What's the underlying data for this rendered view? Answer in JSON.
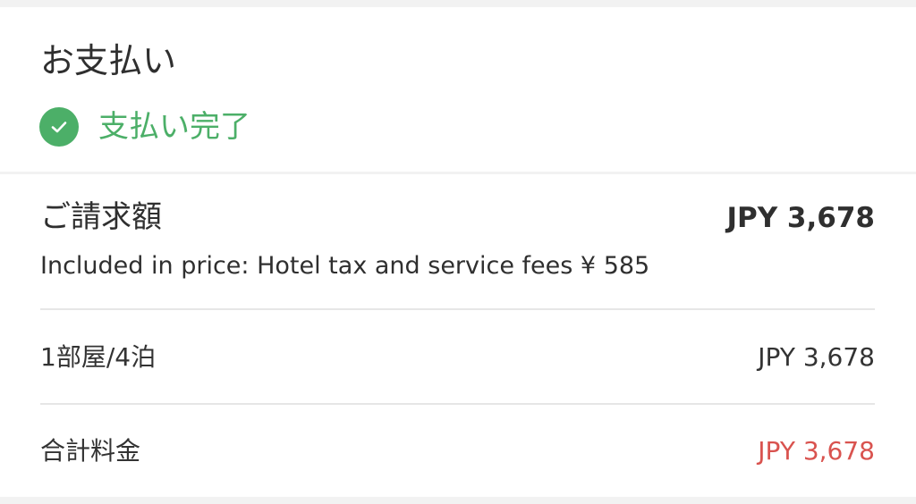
{
  "payment": {
    "title": "お支払い",
    "status_icon": "check-circle-icon",
    "status_text": "支払い完了",
    "status_color": "#4caf68"
  },
  "bill": {
    "label": "ご請求額",
    "total": "JPY 3,678",
    "included_note": "Included in price: Hotel tax and service fees ¥ 585",
    "rows": [
      {
        "label": "1部屋/4泊",
        "value": "JPY 3,678"
      },
      {
        "label": "合計料金",
        "value": "JPY 3,678",
        "value_color": "#d9534f"
      }
    ]
  }
}
